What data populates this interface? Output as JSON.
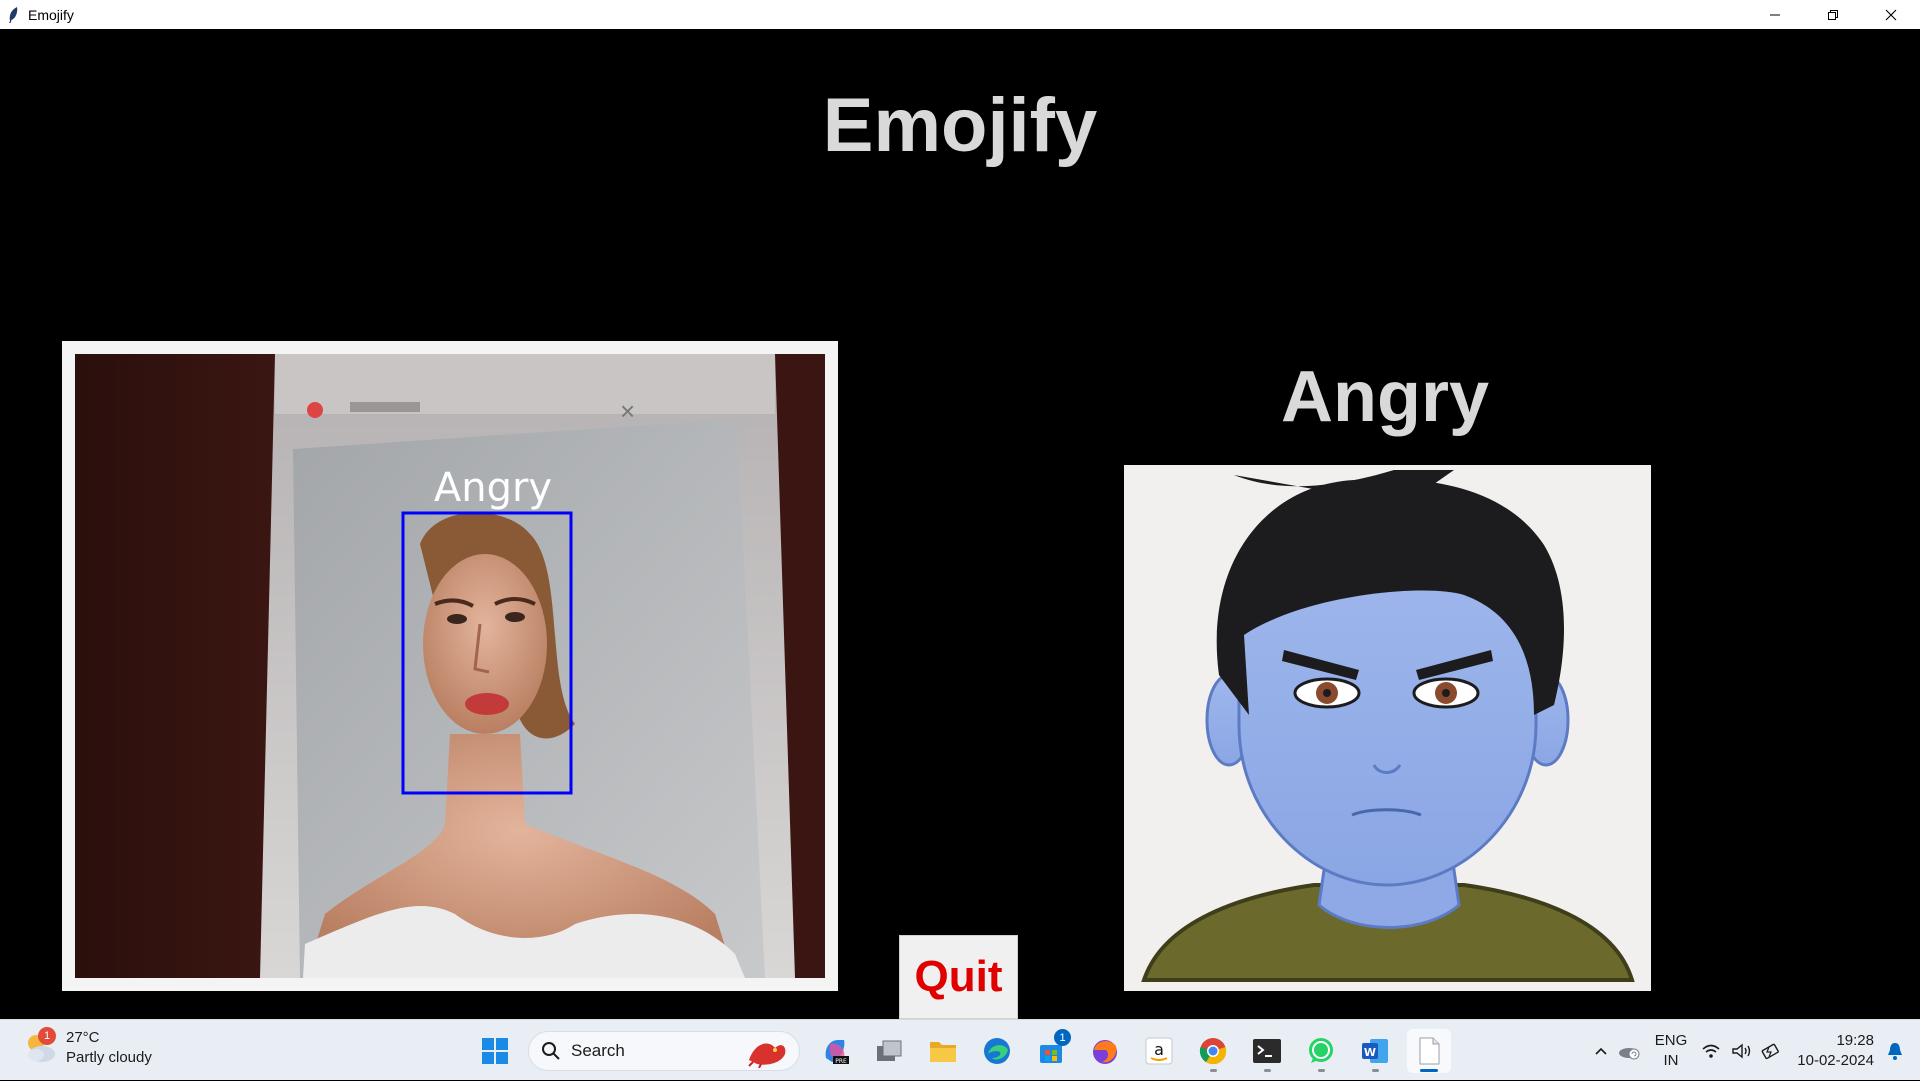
{
  "window": {
    "title": "Emojify"
  },
  "app": {
    "heading": "Emojify",
    "face_box_label": "Angry",
    "emotion_label": "Angry",
    "quit_label": "Quit",
    "colors": {
      "background": "#000000",
      "heading_text": "#d9d9d9",
      "quit_text": "#e00000",
      "face_box": "#0000ff"
    }
  },
  "taskbar": {
    "weather": {
      "temperature": "27°C",
      "condition": "Partly cloudy",
      "badge": "1"
    },
    "search_label": "Search",
    "pinned": [
      {
        "name": "start-icon"
      },
      {
        "name": "copilot-icon"
      },
      {
        "name": "task-view-icon"
      },
      {
        "name": "file-explorer-icon"
      },
      {
        "name": "edge-icon"
      },
      {
        "name": "microsoft-store-icon",
        "badge": "1"
      },
      {
        "name": "firefox-icon"
      },
      {
        "name": "amazon-icon"
      },
      {
        "name": "chrome-icon"
      },
      {
        "name": "terminal-icon"
      },
      {
        "name": "whatsapp-icon"
      },
      {
        "name": "word-icon"
      },
      {
        "name": "notepad-icon"
      }
    ],
    "tray": {
      "language_line1": "ENG",
      "language_line2": "IN",
      "time": "19:28",
      "date": "10-02-2024"
    }
  }
}
